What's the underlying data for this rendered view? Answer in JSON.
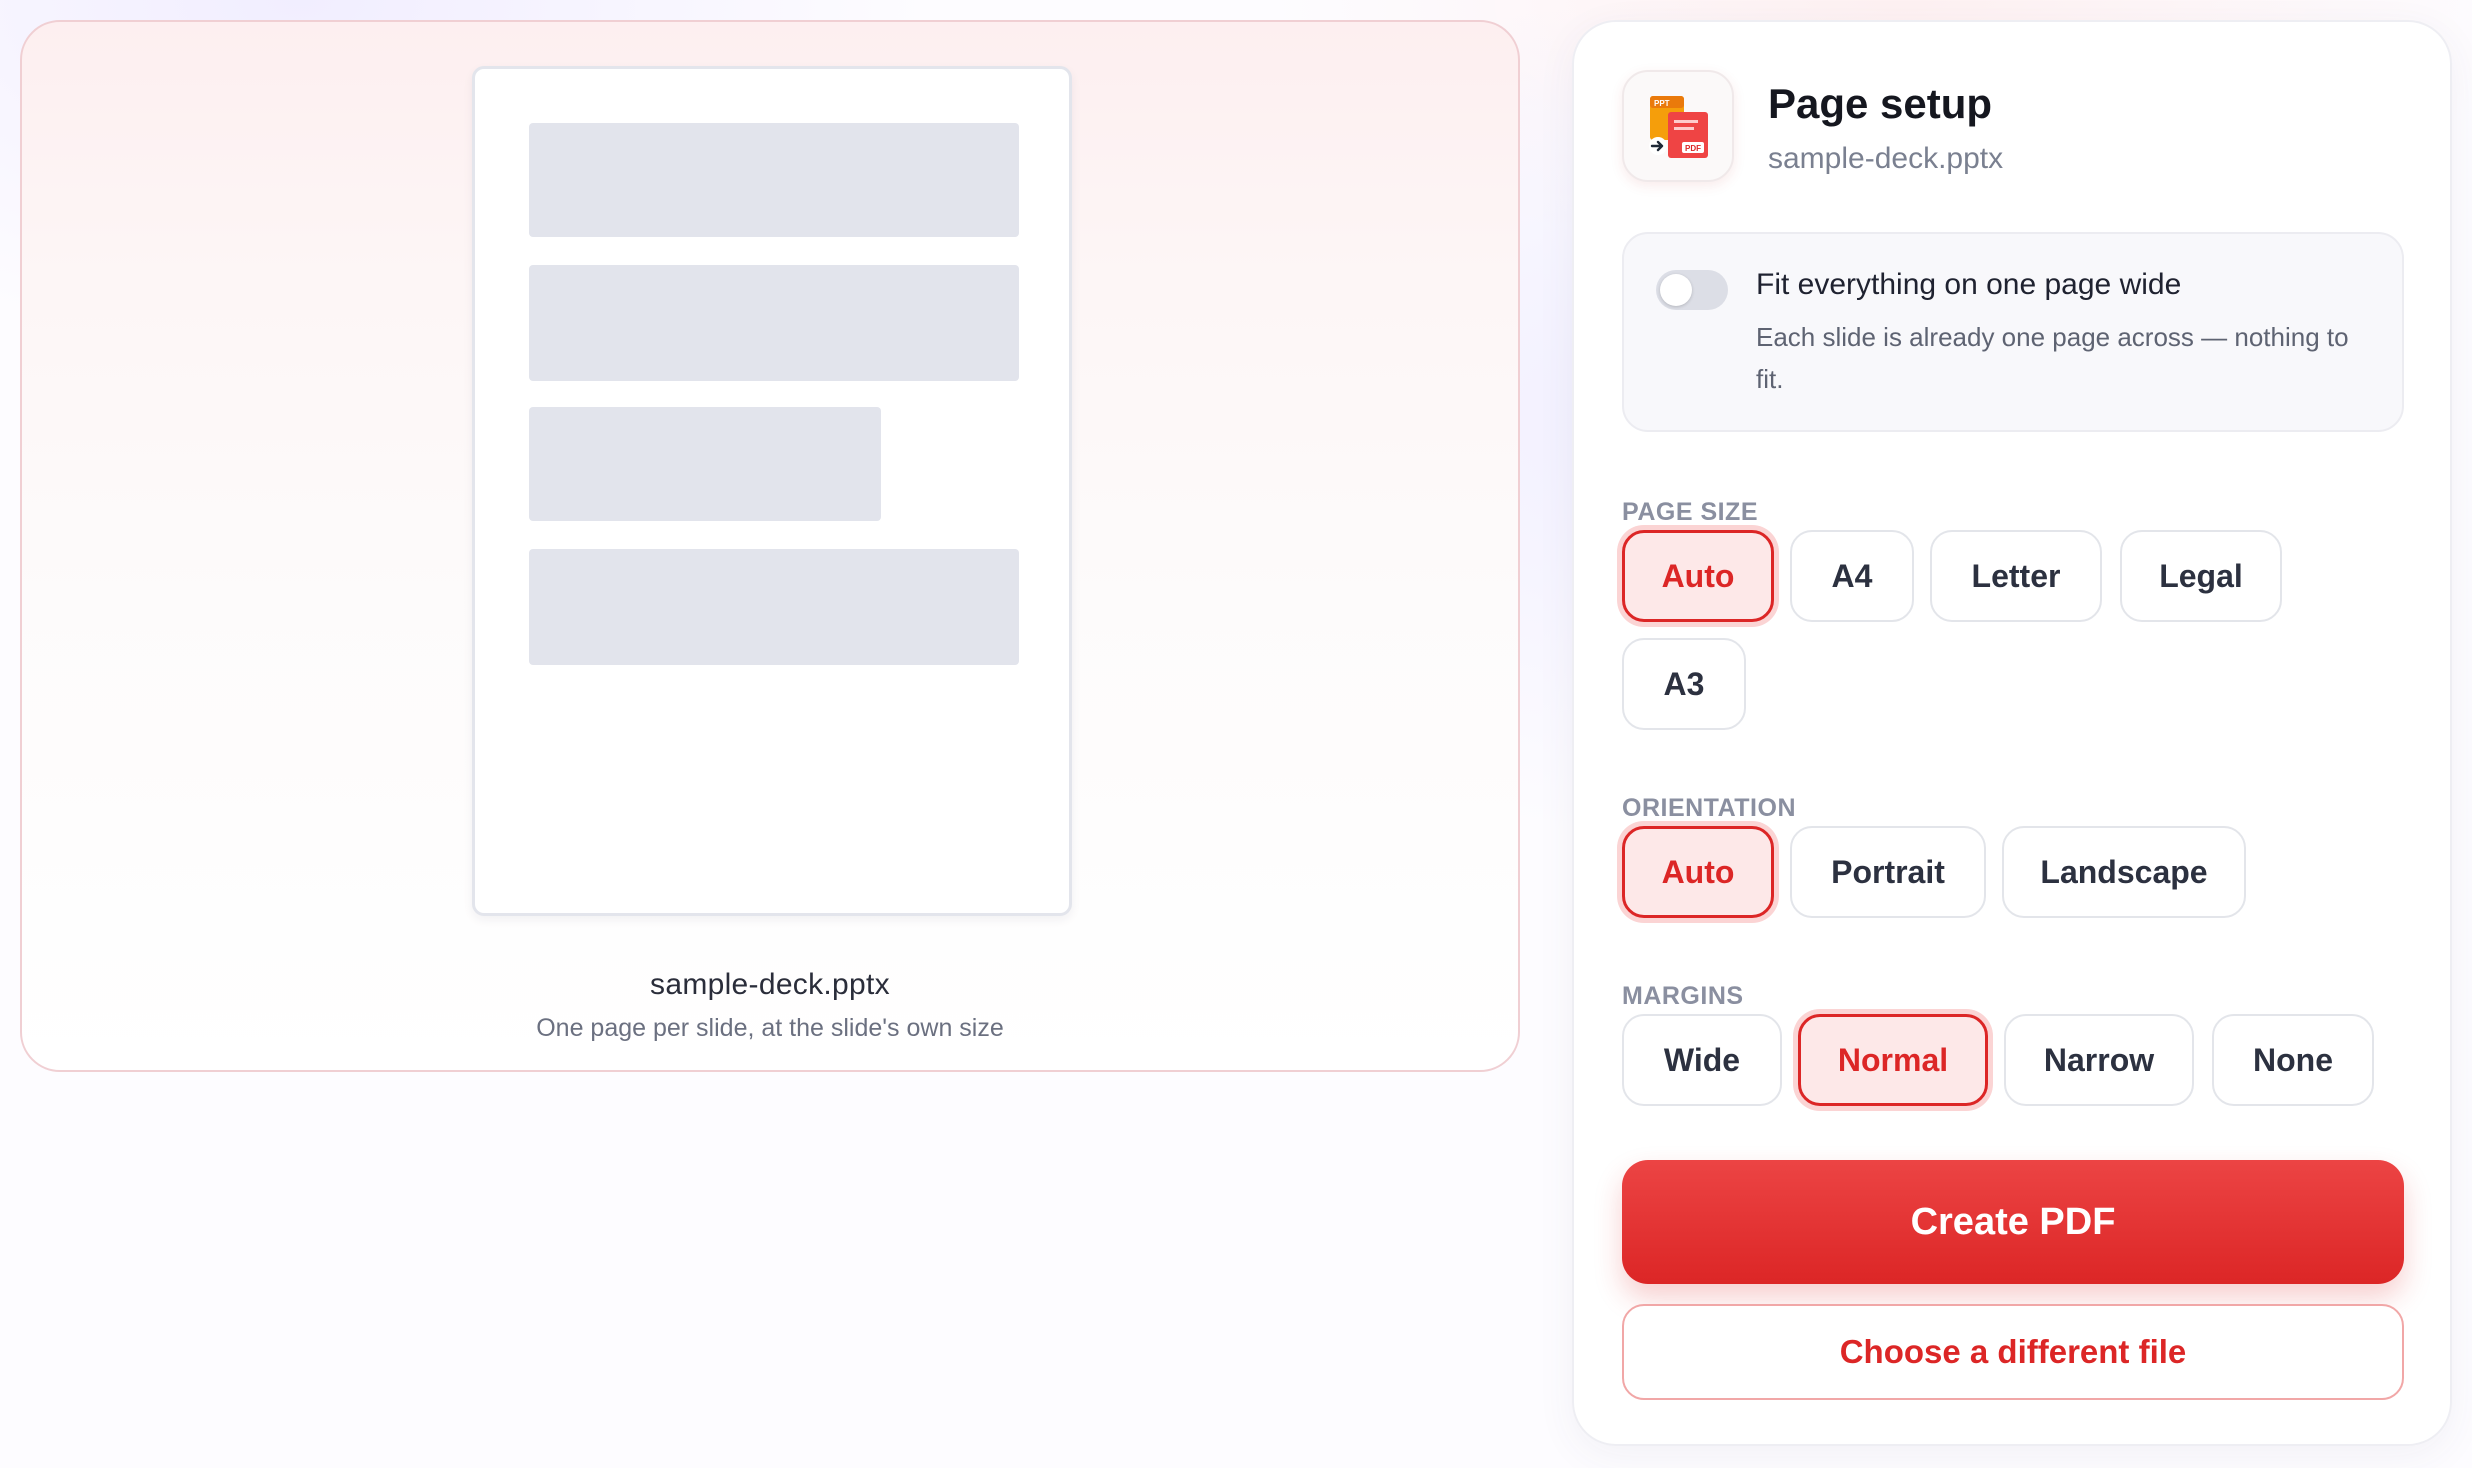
{
  "preview": {
    "file_name": "sample-deck.pptx",
    "caption": "One page per slide, at the slide's own size"
  },
  "panel": {
    "title": "Page setup",
    "subtitle": "sample-deck.pptx",
    "app_icon": {
      "name": "ppt-to-pdf-icon",
      "badge_top": "PPT",
      "badge_bottom": "PDF"
    },
    "fit": {
      "title": "Fit everything on one page wide",
      "description": "Each slide is already one page across — nothing to fit.",
      "enabled": false
    },
    "page_size": {
      "label": "PAGE SIZE",
      "options": [
        "Auto",
        "A4",
        "Letter",
        "Legal",
        "A3"
      ],
      "selected": "Auto"
    },
    "orientation": {
      "label": "ORIENTATION",
      "options": [
        "Auto",
        "Portrait",
        "Landscape"
      ],
      "selected": "Auto"
    },
    "margins": {
      "label": "MARGINS",
      "options": [
        "Wide",
        "Normal",
        "Narrow",
        "None"
      ],
      "selected": "Normal"
    },
    "create_button": "Create PDF",
    "change_file_button": "Choose a different file"
  },
  "colors": {
    "accent": "#dc2626",
    "accent_light": "#fde8e8",
    "skeleton": "#e2e4ec"
  }
}
